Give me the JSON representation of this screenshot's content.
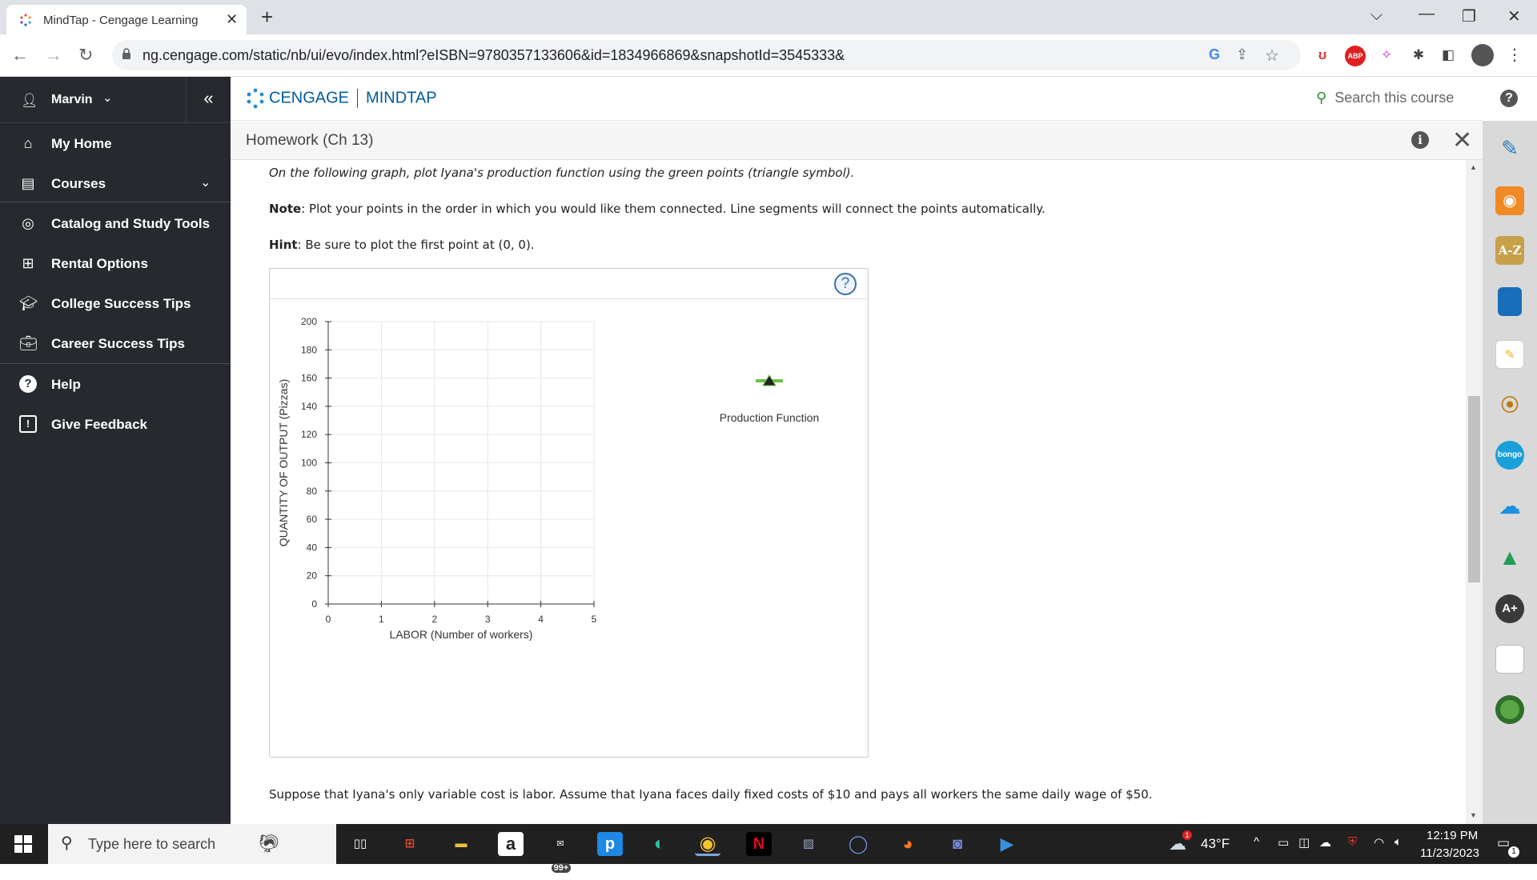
{
  "browser": {
    "tab_title": "MindTap - Cengage Learning",
    "url": "ng.cengage.com/static/nb/ui/evo/index.html?eISBN=9780357133606&id=1834966869&snapshotId=3545333&"
  },
  "sidebar": {
    "user": "Marvin",
    "items": [
      {
        "label": "My Home",
        "icon": "home-icon"
      },
      {
        "label": "Courses",
        "icon": "book-icon"
      },
      {
        "label": "Catalog and Study Tools",
        "icon": "compass-icon"
      },
      {
        "label": "Rental Options",
        "icon": "rental-book-icon"
      },
      {
        "label": "College Success Tips",
        "icon": "graduation-cap-icon"
      },
      {
        "label": "Career Success Tips",
        "icon": "briefcase-icon"
      },
      {
        "label": "Help",
        "icon": "question-icon"
      },
      {
        "label": "Give Feedback",
        "icon": "feedback-icon"
      }
    ]
  },
  "header": {
    "brand_left": "CENGAGE",
    "brand_right": "MINDTAP",
    "search_placeholder": "Search this course"
  },
  "assignment": {
    "title": "Homework (Ch 13)"
  },
  "content": {
    "instruction": "On the following graph, plot Iyana's production function using the green points (triangle symbol).",
    "note_label": "Note",
    "note_text": ": Plot your points in the order in which you would like them connected. Line segments will connect the points automatically.",
    "hint_label": "Hint",
    "hint_text": ": Be sure to plot the first point at (0, 0).",
    "footer": "Suppose that Iyana's only variable cost is labor. Assume that Iyana faces daily fixed costs of $10 and pays all workers the same daily wage of $50.",
    "legend_label": "Production Function"
  },
  "chart_data": {
    "type": "line",
    "xlabel": "LABOR (Number of workers)",
    "ylabel": "QUANTITY OF OUTPUT (Pizzas)",
    "xlim": [
      0,
      5
    ],
    "ylim": [
      0,
      200
    ],
    "xticks": [
      "0",
      "1",
      "2",
      "3",
      "4",
      "5"
    ],
    "yticks": [
      "0",
      "20",
      "40",
      "60",
      "80",
      "100",
      "120",
      "140",
      "160",
      "180",
      "200"
    ],
    "grid": true,
    "series": [
      {
        "name": "Production Function",
        "color": "#6cc04a",
        "marker": "triangle",
        "values": []
      }
    ]
  },
  "taskbar": {
    "search_placeholder": "Type here to search",
    "mail_badge": "99+",
    "weather": "43°F",
    "weather_badge": "1",
    "time": "12:19 PM",
    "date": "11/23/2023",
    "notif_count": "1"
  }
}
